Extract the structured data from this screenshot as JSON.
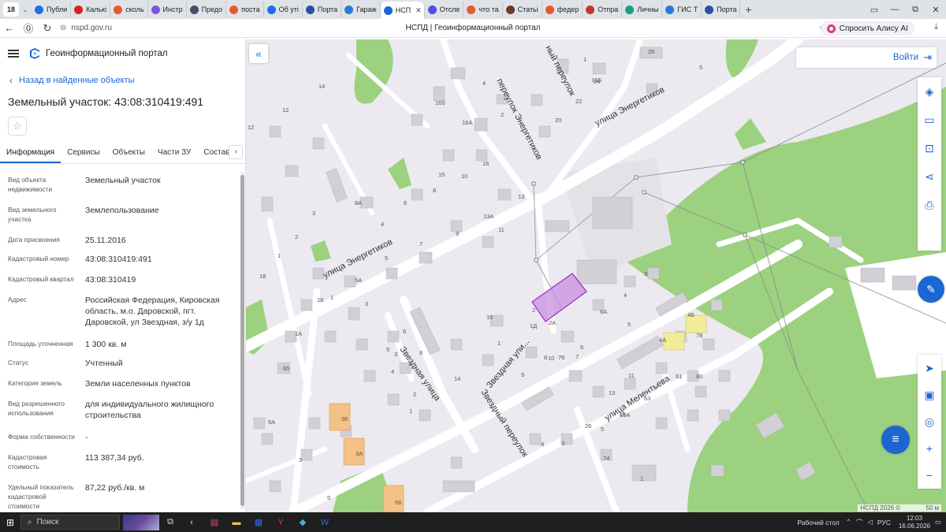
{
  "browser": {
    "tab_count": "18",
    "tabs": [
      {
        "label": "Публи",
        "color": "#1e6fe6"
      },
      {
        "label": "Калькі",
        "color": "#d32323"
      },
      {
        "label": "сколь",
        "color": "#e65b2a"
      },
      {
        "label": "Инстр",
        "color": "#7e56d9"
      },
      {
        "label": "Предо",
        "color": "#444d6a"
      },
      {
        "label": "поста",
        "color": "#e65b2a"
      },
      {
        "label": "Об уті",
        "color": "#1e6fe6"
      },
      {
        "label": "Порта",
        "color": "#2b4ea8"
      },
      {
        "label": "Гараж",
        "color": "#2b7bd6"
      },
      {
        "label": "НСП",
        "color": "#1a66d2",
        "active": true
      },
      {
        "label": "Отсле",
        "color": "#4f4fe6"
      },
      {
        "label": "что та",
        "color": "#e65b2a"
      },
      {
        "label": "Статьі",
        "color": "#6b3b2b"
      },
      {
        "label": "федер",
        "color": "#e65b2a"
      },
      {
        "label": "Отпра",
        "color": "#c0392b"
      },
      {
        "label": "Личны",
        "color": "#16a085"
      },
      {
        "label": "ГИС Т",
        "color": "#2b7bd6"
      },
      {
        "label": "Порта",
        "color": "#2b4ea8"
      }
    ],
    "url": "nspd.gov.ru",
    "page_title": "НСПД | Геоинформационный портал",
    "alice": "Спросить Алису AI"
  },
  "panel": {
    "portal_name": "Геоинформационный портал",
    "back_link": "Назад в найденные объекты",
    "title": "Земельный участок: 43:08:310419:491",
    "tabs": [
      "Информация",
      "Сервисы",
      "Объекты",
      "Части ЗУ",
      "Состав"
    ],
    "fields": [
      {
        "label": "Вид объекта недвижимости",
        "value": "Земельный участок"
      },
      {
        "label": "Вид земельного участка",
        "value": "Землепользование"
      },
      {
        "label": "Дата присвоения",
        "value": "25.11.2016"
      },
      {
        "label": "Кадастровый номер",
        "value": "43:08:310419:491"
      },
      {
        "label": "Кадастровый квартал",
        "value": "43:08:310419"
      },
      {
        "label": "Адрес",
        "value": "Российская Федерация, Кировская область, м.о. Даровской, пгт. Даровской, ул Звездная, з/у 1д"
      },
      {
        "label": "Площадь уточненная",
        "value": "1 300 кв. м"
      },
      {
        "label": "Статус",
        "value": "Учтенный"
      },
      {
        "label": "Категория земель",
        "value": "Земли населенных пунктов"
      },
      {
        "label": "Вид разрешенного использования",
        "value": "для индивидуального жилищного строительства"
      },
      {
        "label": "Форма собственности",
        "value": "-"
      },
      {
        "label": "Кадастровая стоимость",
        "value": "113 387,34 руб."
      },
      {
        "label": "Удельный показатель кадастровой стоимости",
        "value": "87,22 руб./кв. м"
      }
    ]
  },
  "map": {
    "login": "Войти",
    "streets": {
      "energetikov_1": "улица Энергетиков",
      "energetikov_2": "улица Энергетиков",
      "zvezdnaya_1": "Звездная улица",
      "zvezdnaya_2": "Звездная ули...",
      "zvezdny_per": "Звездный переулок",
      "energ_per": "переулок Энергетиков",
      "meleteva": "улица Мелентьева",
      "top_per": "ный переулок"
    },
    "house_numbers": [
      "26",
      "5",
      "1",
      "16Б",
      "4",
      "2",
      "20",
      "24",
      "22",
      "14",
      "12",
      "16б",
      "16А",
      "16",
      "10",
      "8",
      "8А",
      "6",
      "4",
      "3",
      "2",
      "1",
      "18",
      "12",
      "15",
      "13",
      "13А",
      "11",
      "9",
      "7",
      "5",
      "5А",
      "3",
      "1",
      "18",
      "1А",
      "1Д",
      "1",
      "2",
      "2А",
      "3",
      "4",
      "4А",
      "4Б",
      "5",
      "6А",
      "6",
      "7",
      "8",
      "9",
      "10",
      "11",
      "13",
      "15",
      "10А",
      "26",
      "3",
      "4",
      "5",
      "1",
      "74",
      "76",
      "78",
      "80",
      "61",
      "63",
      "65",
      "36",
      "3А",
      "56",
      "5А",
      "3",
      "5",
      "6",
      "8",
      "5",
      "4",
      "3",
      "2",
      "1",
      "14",
      "16"
    ],
    "copyright": "НСПД 2026 ©",
    "scale": "50 м"
  },
  "taskbar": {
    "search": "Поиск",
    "desktop": "Рабочий стол",
    "lang": "РУС",
    "time": "12:03",
    "date": "16.06.2026"
  },
  "colors": {
    "accent": "#1a66d2",
    "parcel_fill": "#c98ee0",
    "parcel_stroke": "#9b2fc0",
    "forest": "#9bd17f",
    "building_orange": "#f4c186",
    "building_yellow": "#f2ec9a",
    "taskbar": "#1f1f1f"
  }
}
